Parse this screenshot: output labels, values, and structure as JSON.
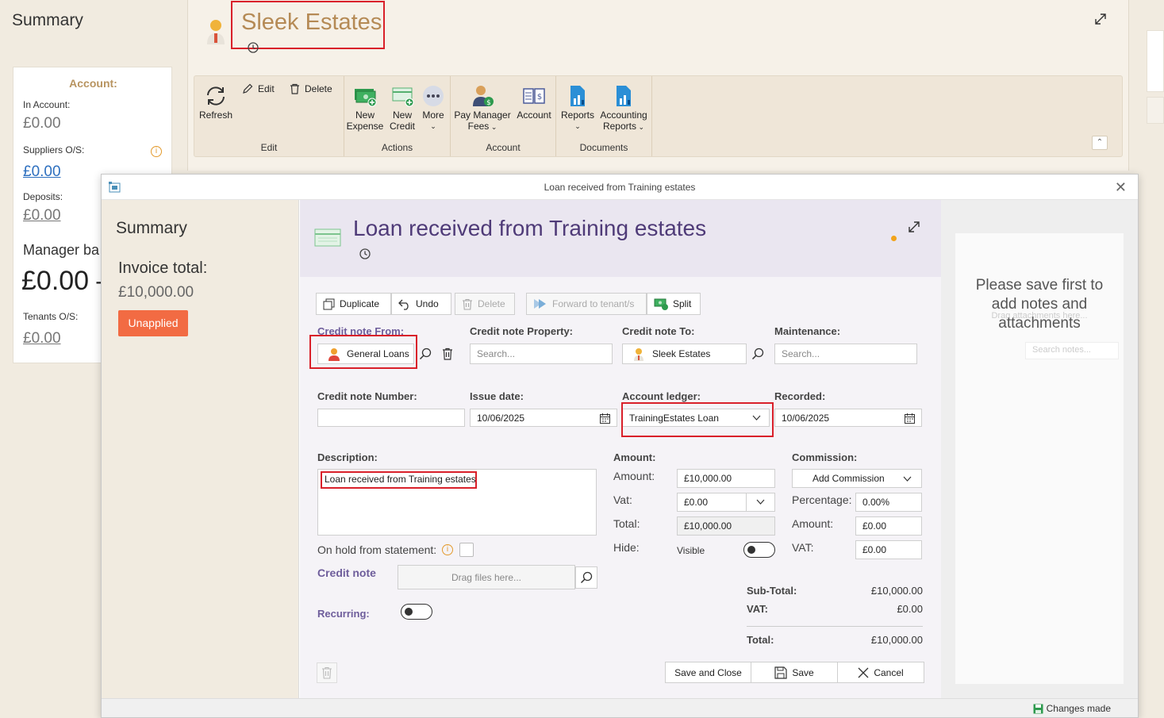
{
  "background": {
    "summary_title": "Summary",
    "account_heading": "Account:",
    "in_account_label": "In Account:",
    "in_account_value": "£0.00",
    "suppliers_label": "Suppliers O/S:",
    "suppliers_value": "£0.00",
    "deposits_label": "Deposits:",
    "deposits_value": "£0.00",
    "manager_balance_label": "Manager ba",
    "manager_balance_value": "£0.00 –",
    "tenants_label": "Tenants O/S:",
    "tenants_value": "£0.00",
    "page_title": "Sleek Estates",
    "ribbon": {
      "groups": {
        "edit": "Edit",
        "actions": "Actions",
        "account": "Account",
        "documents": "Documents"
      },
      "refresh": "Refresh",
      "edit_btn": "Edit",
      "delete_btn": "Delete",
      "new_expense": [
        "New",
        "Expense"
      ],
      "new_credit": [
        "New",
        "Credit"
      ],
      "more": "More",
      "pay_manager_fees": [
        "Pay Manager",
        "Fees"
      ],
      "account_btn": "Account",
      "reports": "Reports",
      "accounting_reports": [
        "Accounting",
        "Reports"
      ]
    }
  },
  "dialog": {
    "window_title": "Loan received from Training estates",
    "left": {
      "summary_title": "Summary",
      "invoice_total_label": "Invoice total:",
      "invoice_total_value": "£10,000.00",
      "status": "Unapplied"
    },
    "heading": "Loan received from Training estates",
    "toolbar": {
      "duplicate": "Duplicate",
      "undo": "Undo",
      "delete": "Delete",
      "forward": "Forward to tenant/s",
      "split": "Split"
    },
    "fields": {
      "from_label": "Credit note From:",
      "from_value": "General Loans",
      "property_label": "Credit note Property:",
      "property_placeholder": "Search...",
      "to_label": "Credit note To:",
      "to_value": "Sleek Estates",
      "maintenance_label": "Maintenance:",
      "maintenance_placeholder": "Search...",
      "number_label": "Credit note Number:",
      "number_value": "",
      "issue_label": "Issue date:",
      "issue_value": "10/06/2025",
      "ledger_label": "Account ledger:",
      "ledger_value": "TrainingEstates Loan",
      "recorded_label": "Recorded:",
      "recorded_value": "10/06/2025",
      "description_label": "Description:",
      "description_value": "Loan received from Training estates",
      "on_hold_label": "On hold from statement:",
      "credit_note_label": "Credit note",
      "drag_placeholder": "Drag files here...",
      "recurring_label": "Recurring:"
    },
    "amount": {
      "section_label": "Amount:",
      "amount_label": "Amount:",
      "amount_value": "£10,000.00",
      "vat_label": "Vat:",
      "vat_value": "£0.00",
      "total_label": "Total:",
      "total_value": "£10,000.00",
      "hide_label": "Hide:",
      "hide_state": "Visible"
    },
    "commission": {
      "section_label": "Commission:",
      "add_commission": "Add Commission",
      "percentage_label": "Percentage:",
      "percentage_value": "0.00%",
      "amount_label": "Amount:",
      "amount_value": "£0.00",
      "vat_label": "VAT:",
      "vat_value": "£0.00"
    },
    "totals": {
      "subtotal_label": "Sub-Total:",
      "subtotal_value": "£10,000.00",
      "vat_label": "VAT:",
      "vat_value": "£0.00",
      "total_label": "Total:",
      "total_value": "£10,000.00"
    },
    "footer": {
      "save_close": "Save and Close",
      "save": "Save",
      "cancel": "Cancel"
    },
    "notes": {
      "message": "Please save first to add notes and attachments",
      "drag": "Drag attachments here...",
      "search_placeholder": "Search notes..."
    },
    "status_bar": "Changes made"
  },
  "colors": {
    "accent_brown": "#b58a55",
    "heading_purple": "#4f3b78",
    "status_orange": "#f26b43",
    "highlight_red": "#d9202a",
    "link_blue": "#2d6fbf"
  }
}
